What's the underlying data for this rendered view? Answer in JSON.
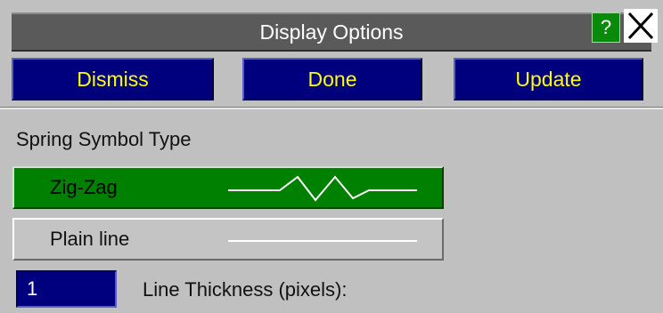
{
  "window": {
    "title": "Display Options",
    "help_label": "?",
    "close_icon": "close-x-icon"
  },
  "actions": {
    "dismiss_label": "Dismiss",
    "done_label": "Done",
    "update_label": "Update"
  },
  "spring": {
    "section_label": "Spring Symbol Type",
    "options": [
      {
        "label": "Zig-Zag",
        "selected": true,
        "icon": "zigzag-spring-icon"
      },
      {
        "label": "Plain line",
        "selected": false,
        "icon": "plain-line-icon"
      }
    ]
  },
  "thickness": {
    "value": "1",
    "label": "Line Thickness (pixels):"
  },
  "colors": {
    "title_bar": "#5a5a5a",
    "button_bg": "#00007e",
    "button_text": "#ffff00",
    "selected_bg": "#008000",
    "panel_bg": "#c0c0c0"
  }
}
